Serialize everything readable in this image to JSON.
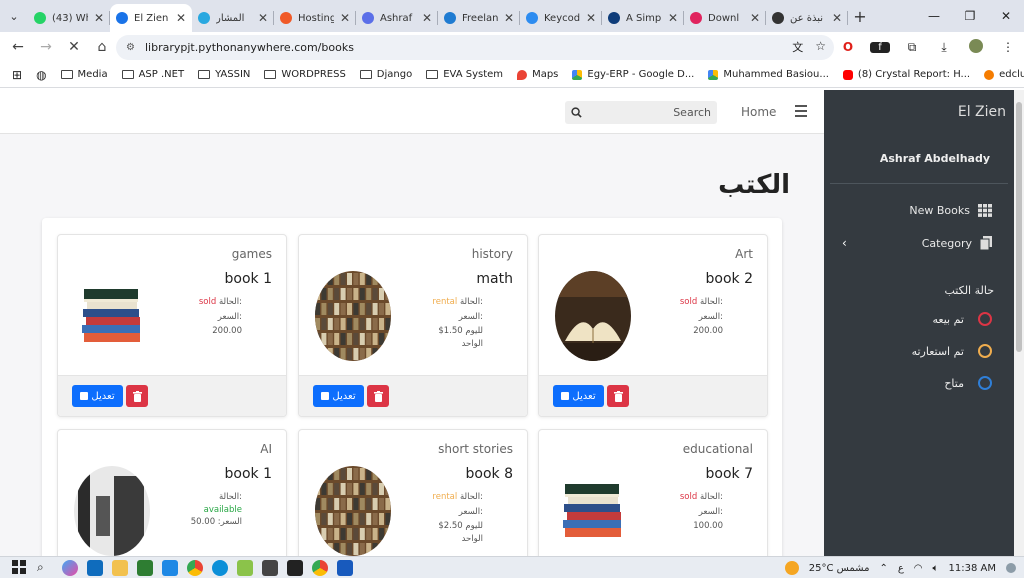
{
  "browser": {
    "tabs": [
      {
        "title": "(43) Wh",
        "color": "#25d366",
        "active": false
      },
      {
        "title": "El Zien",
        "color": "#1a73e8",
        "active": true
      },
      {
        "title": "المشار",
        "color": "#29a8e0",
        "active": false
      },
      {
        "title": "Hosting",
        "color": "#f05a28",
        "active": false
      },
      {
        "title": "Ashraf",
        "color": "#5b6fe8",
        "active": false
      },
      {
        "title": "Freelan",
        "color": "#1f7bd1",
        "active": false
      },
      {
        "title": "Keycod",
        "color": "#2d8cf0",
        "active": false
      },
      {
        "title": "A Simp",
        "color": "#0f3d7a",
        "active": false
      },
      {
        "title": "Downl",
        "color": "#e0245e",
        "active": false
      },
      {
        "title": "نبذة عن",
        "color": "#333333",
        "active": false
      }
    ],
    "url": "librarypjt.pythonanywhere.com/books",
    "bookmarks": [
      {
        "label": "Media",
        "type": "folder"
      },
      {
        "label": "ASP .NET",
        "type": "folder"
      },
      {
        "label": "YASSIN",
        "type": "folder"
      },
      {
        "label": "WORDPRESS",
        "type": "folder"
      },
      {
        "label": "Django",
        "type": "folder"
      },
      {
        "label": "EVA System",
        "type": "folder"
      },
      {
        "label": "Maps",
        "type": "maps"
      },
      {
        "label": "Egy-ERP - Google D...",
        "type": "drive"
      },
      {
        "label": "Muhammed Basiou...",
        "type": "drive"
      },
      {
        "label": "(8) Crystal Report: H...",
        "type": "youtube"
      },
      {
        "label": "edclub",
        "type": "edclub"
      }
    ]
  },
  "nav": {
    "search_placeholder": "Search",
    "home": "Home"
  },
  "page": {
    "title": "الكتب"
  },
  "labels": {
    "status": "الحالة:",
    "price": "السعر:",
    "edit": "تعديل"
  },
  "books": [
    {
      "category": "Art",
      "name": "book 2",
      "status": "sold",
      "status_color": "#dc3545",
      "price_lines": [
        "200.00"
      ],
      "cover": "open"
    },
    {
      "category": "history",
      "name": "math",
      "status": "rental",
      "status_color": "#f0ad4e",
      "price_lines": [
        "$1.50 لليوم",
        "الواحد"
      ],
      "cover": "shelf"
    },
    {
      "category": "games",
      "name": "book 1",
      "status": "sold",
      "status_color": "#dc3545",
      "price_lines": [
        "200.00"
      ],
      "cover": "stack"
    },
    {
      "category": "educational",
      "name": "book 7",
      "status": "sold",
      "status_color": "#dc3545",
      "price_lines": [
        "100.00"
      ],
      "cover": "stack"
    },
    {
      "category": "short stories",
      "name": "book 8",
      "status": "rental",
      "status_color": "#f0ad4e",
      "price_lines": [
        "$2.50 لليوم",
        "الواحد"
      ],
      "cover": "shelf"
    },
    {
      "category": "AI",
      "name": "book 1",
      "status": "available",
      "status_color": "#28a745",
      "price_inline": "السعر: 50.00",
      "cover": "door"
    }
  ],
  "sidebar": {
    "brand": "El Zien",
    "user": "Ashraf Abdelhady",
    "new_books": "New Books",
    "category": "Category",
    "status_heading": "حالة الكتب",
    "legend": [
      {
        "label": "تم بيعه",
        "color": "#dc3545"
      },
      {
        "label": "تم استعارته",
        "color": "#f0ad4e"
      },
      {
        "label": "متاح",
        "color": "#2f7fd8"
      }
    ]
  },
  "taskbar": {
    "weather": "25°C مشمس",
    "lang": "ع",
    "time": "11:38 AM"
  }
}
